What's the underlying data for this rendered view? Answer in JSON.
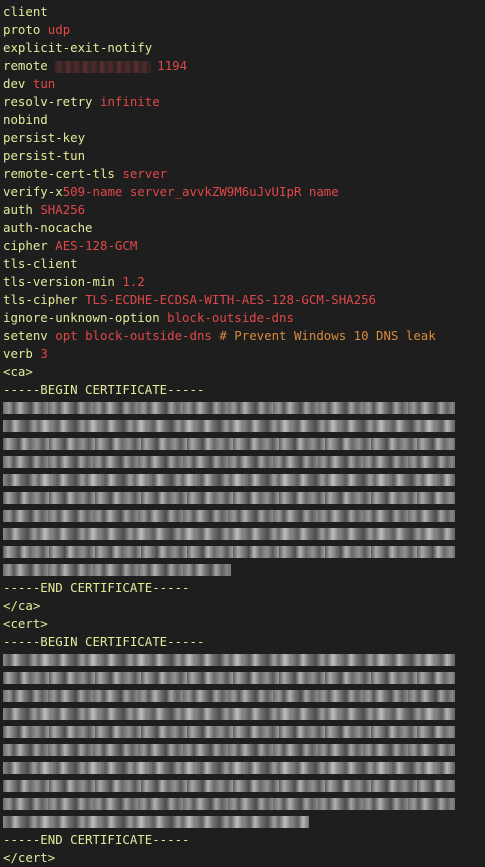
{
  "colors": {
    "background": "#1e1e1e",
    "keyword": "#e4ea9a",
    "value": "#e04848",
    "comment": "#d78a3c"
  },
  "config_lines": [
    {
      "key": "client",
      "value": ""
    },
    {
      "key": "proto",
      "value": "udp"
    },
    {
      "key": "explicit-exit-notify",
      "value": ""
    },
    {
      "key": "remote",
      "value": "1194"
    },
    {
      "key": "dev",
      "value": "tun"
    },
    {
      "key": "resolv-retry",
      "value": "infinite"
    },
    {
      "key": "nobind",
      "value": ""
    },
    {
      "key": "persist-key",
      "value": ""
    },
    {
      "key": "persist-tun",
      "value": ""
    },
    {
      "key": "remote-cert-tls",
      "value": "server"
    },
    {
      "key": "verify-x",
      "value": "509-name server_avvkZW9M6uJvUIpR name"
    },
    {
      "key": "auth",
      "value": "SHA256"
    },
    {
      "key": "auth-nocache",
      "value": ""
    },
    {
      "key": "cipher",
      "value": "AES-128-GCM"
    },
    {
      "key": "tls-client",
      "value": ""
    },
    {
      "key": "tls-version-min",
      "value": "1.2"
    },
    {
      "key": "tls-cipher",
      "value": "TLS-ECDHE-ECDSA-WITH-AES-128-GCM-SHA256"
    },
    {
      "key": "ignore-unknown-option",
      "value": "block-outside-dns"
    },
    {
      "key": "setenv",
      "value": "opt block-outside-dns",
      "comment": "# Prevent Windows 10 DNS leak"
    },
    {
      "key": "verb",
      "value": "3"
    }
  ],
  "ca": {
    "open_tag": "<ca>",
    "begin": "-----BEGIN CERTIFICATE-----",
    "end": "-----END CERTIFICATE-----",
    "close_tag": "</ca>"
  },
  "cert": {
    "open_tag": "<cert>",
    "begin": "-----BEGIN CERTIFICATE-----",
    "end": "-----END CERTIFICATE-----",
    "close_tag": "</cert>"
  }
}
